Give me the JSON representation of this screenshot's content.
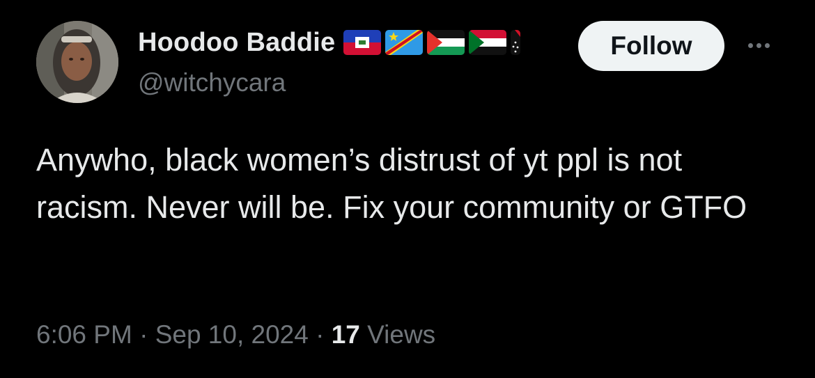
{
  "author": {
    "display_name": "Hoodoo Baddie",
    "handle": "@witchycara",
    "flags": [
      "haiti-flag-icon",
      "dr-congo-flag-icon",
      "palestine-flag-icon",
      "sudan-flag-icon",
      "papua-new-guinea-flag-icon"
    ]
  },
  "follow_label": "Follow",
  "tweet": {
    "text": "Anywho, black women’s distrust of yt ppl is not racism. Never will be. Fix your community or GTFO"
  },
  "meta": {
    "time": "6:06 PM",
    "separator": "·",
    "date": "Sep 10, 2024",
    "views_count": "17",
    "views_label": "Views"
  },
  "colors": {
    "background": "#000000",
    "text_primary": "#e7e9ea",
    "text_secondary": "#71767b",
    "follow_button_bg": "#eff3f4"
  }
}
